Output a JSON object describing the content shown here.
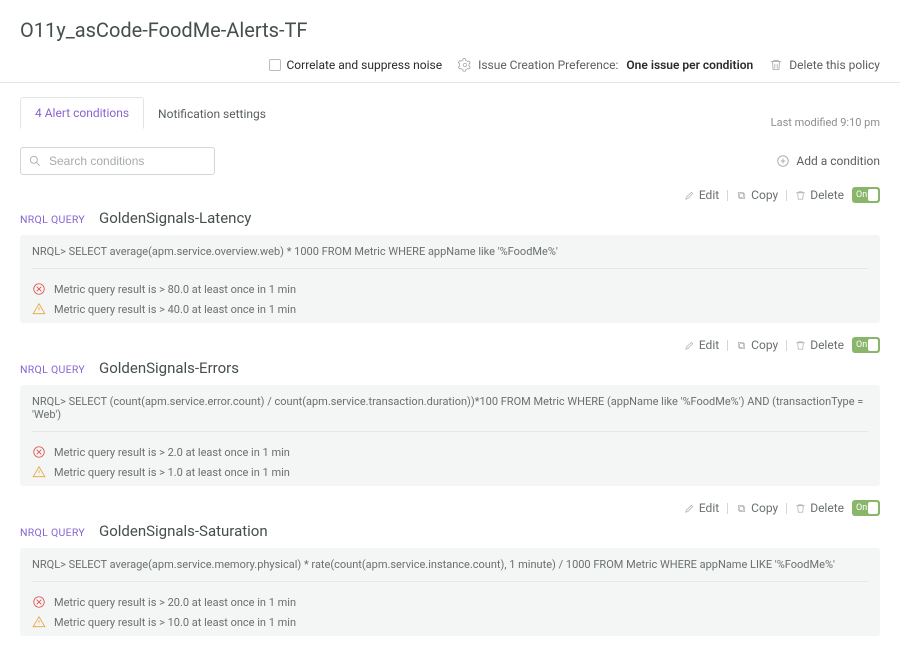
{
  "title": "O11y_asCode-FoodMe-Alerts-TF",
  "header": {
    "correlate_label": "Correlate and suppress noise",
    "pref_label": "Issue Creation Preference:",
    "pref_value": "One issue per condition",
    "delete_label": "Delete this policy"
  },
  "tabs": {
    "alert_conditions": "4 Alert conditions",
    "notification_settings": "Notification settings"
  },
  "last_modified": "Last modified 9:10 pm",
  "search": {
    "placeholder": "Search conditions"
  },
  "add_condition": "Add a condition",
  "actions": {
    "edit": "Edit",
    "copy": "Copy",
    "delete": "Delete",
    "toggle_on": "On"
  },
  "nrql_label": "NRQL QUERY",
  "conditions": [
    {
      "name": "GoldenSignals-Latency",
      "query": "NRQL> SELECT average(apm.service.overview.web) * 1000 FROM Metric WHERE appName like '%FoodMe%'",
      "critical": "Metric query result is > 80.0 at least once in 1 min",
      "warning": "Metric query result is > 40.0 at least once in 1 min"
    },
    {
      "name": "GoldenSignals-Errors",
      "query": "NRQL> SELECT (count(apm.service.error.count) / count(apm.service.transaction.duration))*100 FROM Metric WHERE (appName like '%FoodMe%') AND (transactionType = 'Web')",
      "critical": "Metric query result is > 2.0 at least once in 1 min",
      "warning": "Metric query result is > 1.0 at least once in 1 min"
    },
    {
      "name": "GoldenSignals-Saturation",
      "query": "NRQL> SELECT average(apm.service.memory.physical) * rate(count(apm.service.instance.count), 1 minute) / 1000 FROM Metric WHERE appName LIKE '%FoodMe%'",
      "critical": "Metric query result is > 20.0 at least once in 1 min",
      "warning": "Metric query result is > 10.0 at least once in 1 min"
    }
  ]
}
